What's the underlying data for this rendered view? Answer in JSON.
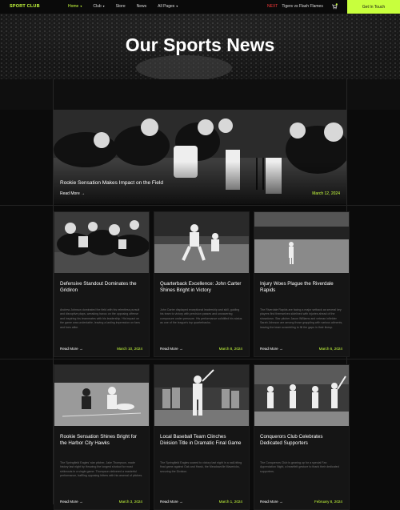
{
  "nav": {
    "brand": "SPORT CLUB",
    "items": [
      {
        "label": "Home",
        "has_caret": true,
        "active": true
      },
      {
        "label": "Club",
        "has_caret": true,
        "active": false
      },
      {
        "label": "Store",
        "has_caret": false,
        "active": false
      },
      {
        "label": "News",
        "has_caret": false,
        "active": false
      },
      {
        "label": "All Pages",
        "has_caret": true,
        "active": false
      }
    ],
    "ticker_tag": "NEXT",
    "ticker_text": "Tigers vs Flash Flames",
    "cart_icon": "cart-icon",
    "cta_label": "Get In Touch"
  },
  "hero": {
    "title": "Our Sports News"
  },
  "featured": {
    "title": "Rookie Sensation Makes Impact on the Field",
    "read_more": "Read More",
    "date": "March 12, 2024"
  },
  "cards": [
    {
      "title": "Defensive Standout Dominates the Gridiron",
      "excerpt": "Andrew Johnson dominated the field with his relentless pursuit and disruptive plays, wreaking havoc on the opposing offense and inspiring his teammates with his leadership. His impact on the game was undeniable, leaving a lasting impression on fans and foes alike.",
      "read_more": "Read More",
      "date": "March 10, 2024"
    },
    {
      "title": "Quarterback Excellence: John Carter Shines Bright in Victory",
      "excerpt": "John Carter displayed exceptional leadership and skill, guiding his team to victory with precision passes and unwavering composure under pressure. His performance solidified his status as one of the league's top quarterbacks.",
      "read_more": "Read More",
      "date": "March 8, 2024"
    },
    {
      "title": "Injury Woes Plague the Riverdale Rapids",
      "excerpt": "The Riverdale Rapids are facing a major setback as several key players find themselves sidelined with injuries ahead of the showdown. Star pitcher Jason Williams and veteran infielder Sarah Johnson are among those grappling with various ailments, leaving the team scrambling to fill the gaps in their lineup.",
      "read_more": "Read More",
      "date": "March 6, 2024"
    },
    {
      "title": "Rookie Sensation Shines Bright for the Harbor City Hawks",
      "excerpt": "The Springfield Eagles' star pitcher, Jake Thompson, made history last night by throwing the longest shutout for most strikeouts in a single game. Thompson delivered a masterful performance, baffling opposing hitters with his arsenal of pitches.",
      "read_more": "Read More",
      "date": "March 3, 2024"
    },
    {
      "title": "Local Baseball Team Clinches Division Title in Dramatic Final Game",
      "excerpt": "The Springfield Eagles soared to victory last night in a nail-biting final game against Oak and Hawk, the Meadowville Mavericks, securing the Division.",
      "read_more": "Read More",
      "date": "March 1, 2024"
    },
    {
      "title": "Conquerors Club Celebrates Dedicated Supporters",
      "excerpt": "The Conquerors Club is gearing up for a special Fan Appreciation Night, a heartfelt gesture to thank their dedicated supporters.",
      "read_more": "Read More",
      "date": "February 8, 2024"
    }
  ],
  "colors": {
    "accent": "#c8ff3d",
    "live": "#ff3b3b",
    "background": "#0b0b0b"
  }
}
